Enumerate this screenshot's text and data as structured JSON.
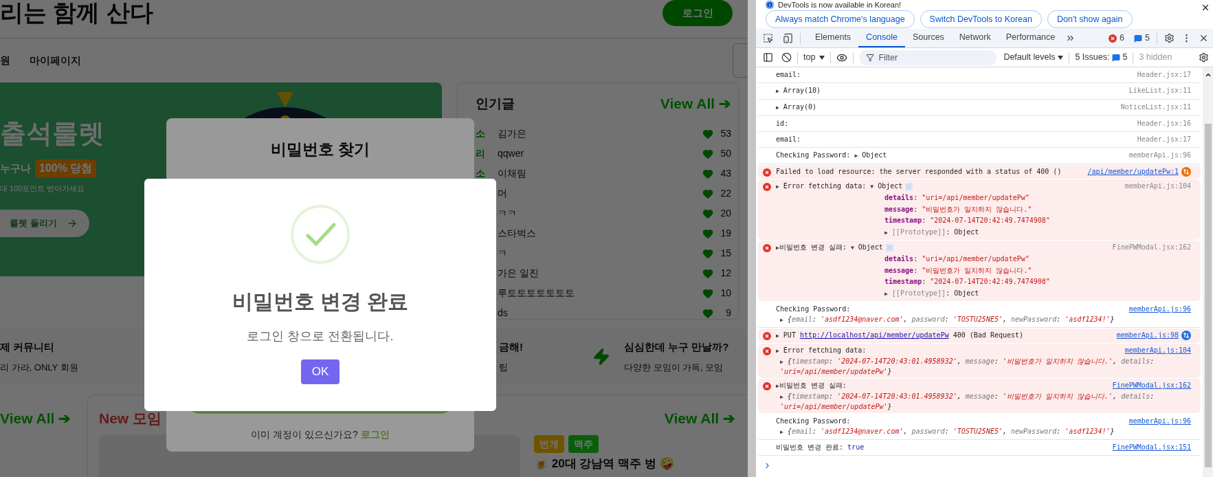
{
  "page": {
    "site_title": "리는 함께 산다",
    "login_button": "로그인",
    "nav": [
      {
        "label": "원"
      },
      {
        "label": "마이페이지"
      }
    ],
    "banner": {
      "title": "출석룰렛",
      "lead": "누구나",
      "badge": "100% 당첨",
      "subtitle": "대 100포인트 받아가세요",
      "button": "룰렛 돌리기"
    },
    "popular": {
      "title": "인기글",
      "view_all": "View All ➔",
      "posts": [
        {
          "category": "소",
          "title": "김가은",
          "likes": "53"
        },
        {
          "category": "리",
          "title": "qqwer",
          "likes": "50"
        },
        {
          "category": "소",
          "title": "이채림",
          "likes": "43"
        },
        {
          "title": "머",
          "likes": "22"
        },
        {
          "title": "ㅋㅋ",
          "likes": "20"
        },
        {
          "title": "스타벅스",
          "likes": "19"
        },
        {
          "title": "ㅋ",
          "likes": "15"
        },
        {
          "title": "가은 일진",
          "likes": "12"
        },
        {
          "title": "루토토토토토토토",
          "likes": "10"
        },
        {
          "title": "ds",
          "likes": "9"
        }
      ]
    },
    "features": [
      {
        "title": "제 커뮤니티",
        "text": "리 가라, ONLY 회원",
        "icon": false
      },
      {
        "title": "금해!",
        "text": "팁",
        "icon": false
      },
      {
        "title": "심심한데 누구 만날까?",
        "text": "다양한 모임이 가득, 모임",
        "icon": true
      }
    ],
    "view_all_left": "View All ➔",
    "meetings": {
      "title": "New 모임",
      "view_all": "View All ➔",
      "tags": [
        {
          "label": "번개",
          "color": "#705400"
        },
        {
          "label": "맥주",
          "color": "#0a600a"
        }
      ],
      "meeting_title": "🍺 20대 강남역 맥주 벙 🤪"
    }
  },
  "find_password_modal": {
    "title": "비밀번호 찾기",
    "footer_text": "이미 계정이 있으신가요? ",
    "footer_link": "로그인"
  },
  "success_modal": {
    "title": "비밀번호 변경 완료",
    "text": "로그인 창으로 전환됩니다.",
    "button": "OK"
  },
  "devtools": {
    "notice": "DevTools is now available in Korean!",
    "notice_buttons": [
      "Always match Chrome's language",
      "Switch DevTools to Korean",
      "Don't show again"
    ],
    "tabs": [
      {
        "label": "Elements",
        "selected": false
      },
      {
        "label": "Console",
        "selected": true
      },
      {
        "label": "Sources",
        "selected": false
      },
      {
        "label": "Network",
        "selected": false
      },
      {
        "label": "Performance",
        "selected": false
      }
    ],
    "error_count": "6",
    "message_count": "5",
    "context": "top",
    "filter_placeholder": "Filter",
    "levels": "Default levels",
    "issues_label": "5 Issues:",
    "issues_count": "5",
    "hidden": "3 hidden",
    "messages": [
      {
        "kind": "log",
        "source": "Header.jsx:17",
        "source_link": false,
        "info_badge": false,
        "segments": [
          {
            "kind": "plain",
            "text": "email:"
          }
        ]
      },
      {
        "kind": "log",
        "source": "LikeList.jsx:11",
        "source_link": false,
        "info_badge": false,
        "segments": [
          {
            "kind": "arrow",
            "text": "▶"
          },
          {
            "kind": "plain",
            "text": " Array(10)"
          }
        ]
      },
      {
        "kind": "log",
        "source": "NoticeList.jsx:11",
        "source_link": false,
        "info_badge": false,
        "segments": [
          {
            "kind": "arrow",
            "text": "▶"
          },
          {
            "kind": "plain",
            "text": " Array(0)"
          }
        ]
      },
      {
        "kind": "log",
        "source": "Header.jsx:16",
        "source_link": false,
        "info_badge": false,
        "segments": [
          {
            "kind": "plain",
            "text": "id:"
          }
        ]
      },
      {
        "kind": "log",
        "source": "Header.jsx:17",
        "source_link": false,
        "info_badge": false,
        "segments": [
          {
            "kind": "plain",
            "text": "email:"
          }
        ]
      },
      {
        "kind": "log",
        "source": "memberApi.js:96",
        "source_link": false,
        "info_badge": false,
        "segments": [
          {
            "kind": "plain",
            "text": "Checking Password: "
          },
          {
            "kind": "arrow",
            "text": "▶"
          },
          {
            "kind": "plain",
            "text": " Object"
          }
        ]
      },
      {
        "kind": "error",
        "source": "/api/member/updatePw:1",
        "source_link": true,
        "info_badge": false,
        "color": "#e8710a",
        "segments": [
          {
            "kind": "plain",
            "text": "Failed to load resource: the server responded with a status of 400 ()"
          }
        ]
      },
      {
        "kind": "error",
        "source": "memberApi.js:104",
        "source_link": false,
        "info_badge": true,
        "segments": [
          {
            "kind": "arrow",
            "text": "▶"
          },
          {
            "kind": "plain",
            "text": " Error fetching data: "
          },
          {
            "kind": "arrow",
            "text": "▼"
          },
          {
            "kind": "plain",
            "text": " Object"
          }
        ],
        "props": [
          [
            {
              "kind": "key",
              "text": "details"
            },
            {
              "kind": "plain",
              "text": ": "
            },
            {
              "kind": "string",
              "text": "\"uri=/api/member/updatePw\""
            }
          ],
          [
            {
              "kind": "key",
              "text": "message"
            },
            {
              "kind": "plain",
              "text": ": "
            },
            {
              "kind": "string",
              "text": "\"비밀번호가 일치하지 않습니다.\""
            }
          ],
          [
            {
              "kind": "key",
              "text": "timestamp"
            },
            {
              "kind": "plain",
              "text": ": "
            },
            {
              "kind": "string",
              "text": "\"2024-07-14T20:42:49.7474908\""
            }
          ],
          [
            {
              "kind": "arrow",
              "text": "▶"
            },
            {
              "kind": "proto",
              "text": " [[Prototype]]"
            },
            {
              "kind": "plain",
              "text": ": Object"
            }
          ]
        ]
      },
      {
        "kind": "error",
        "source": "FinePWModal.jsx:162",
        "source_link": false,
        "info_badge": true,
        "segments": [
          {
            "kind": "arrow",
            "text": "▶"
          },
          {
            "kind": "plain",
            "text": "비밀번호 변경 실패: "
          },
          {
            "kind": "arrow",
            "text": "▼"
          },
          {
            "kind": "plain",
            "text": " Object"
          }
        ],
        "props": [
          [
            {
              "kind": "key",
              "text": "details"
            },
            {
              "kind": "plain",
              "text": ": "
            },
            {
              "kind": "string",
              "text": "\"uri=/api/member/updatePw\""
            }
          ],
          [
            {
              "kind": "key",
              "text": "message"
            },
            {
              "kind": "plain",
              "text": ": "
            },
            {
              "kind": "string",
              "text": "\"비밀번호가 일치하지 않습니다.\""
            }
          ],
          [
            {
              "kind": "key",
              "text": "timestamp"
            },
            {
              "kind": "plain",
              "text": ": "
            },
            {
              "kind": "string",
              "text": "\"2024-07-14T20:42:49.7474908\""
            }
          ],
          [
            {
              "kind": "arrow",
              "text": "▶"
            },
            {
              "kind": "proto",
              "text": " [[Prototype]]"
            },
            {
              "kind": "plain",
              "text": ": Object"
            }
          ]
        ]
      },
      {
        "kind": "log",
        "source": "memberApi.js:96",
        "source_link": true,
        "info_badge": false,
        "segments": [
          {
            "kind": "plain",
            "text": "Checking Password:"
          }
        ],
        "preview": [
          {
            "kind": "arrow",
            "text": "▶"
          },
          {
            "kind": "plain",
            "text": " {"
          },
          {
            "kind": "dim",
            "text": "email"
          },
          {
            "kind": "plain",
            "text": ": "
          },
          {
            "kind": "string",
            "text": "'asdf1234@naver.com'"
          },
          {
            "kind": "plain",
            "text": ", "
          },
          {
            "kind": "dim",
            "text": "password"
          },
          {
            "kind": "plain",
            "text": ": "
          },
          {
            "kind": "string",
            "text": "'TOSTU25NE5'"
          },
          {
            "kind": "plain",
            "text": ", "
          },
          {
            "kind": "dim",
            "text": "newPassword"
          },
          {
            "kind": "plain",
            "text": ": "
          },
          {
            "kind": "string",
            "text": "'asdf1234!'"
          },
          {
            "kind": "plain",
            "text": "}"
          }
        ]
      },
      {
        "kind": "error",
        "source": "memberApi.js:98",
        "source_link": true,
        "info_badge": false,
        "color": "#1a73e8",
        "segments": [
          {
            "kind": "arrow",
            "text": "▶"
          },
          {
            "kind": "plain",
            "text": " PUT "
          },
          {
            "kind": "link",
            "text": "http://localhost/api/member/updatePw"
          },
          {
            "kind": "plain",
            "text": " 400 (Bad Request)"
          }
        ]
      },
      {
        "kind": "error",
        "source": "memberApi.js:104",
        "source_link": true,
        "info_badge": false,
        "segments": [
          {
            "kind": "arrow",
            "text": "▶"
          },
          {
            "kind": "plain",
            "text": " Error fetching data:"
          }
        ],
        "preview": [
          {
            "kind": "arrow",
            "text": "▶"
          },
          {
            "kind": "plain",
            "text": " {"
          },
          {
            "kind": "dim",
            "text": "timestamp"
          },
          {
            "kind": "plain",
            "text": ": "
          },
          {
            "kind": "string",
            "text": "'2024-07-14T20:43:01.4958932'"
          },
          {
            "kind": "plain",
            "text": ", "
          },
          {
            "kind": "dim",
            "text": "message"
          },
          {
            "kind": "plain",
            "text": ": "
          },
          {
            "kind": "string",
            "text": "'비밀번호가 일치하지 않습니다.'"
          },
          {
            "kind": "plain",
            "text": ", "
          },
          {
            "kind": "dim",
            "text": "details"
          },
          {
            "kind": "plain",
            "text": ": "
          },
          {
            "kind": "string",
            "text": "'uri=/api/member/updatePw'"
          },
          {
            "kind": "plain",
            "text": "}"
          }
        ]
      },
      {
        "kind": "error",
        "source": "FinePWModal.jsx:162",
        "source_link": true,
        "info_badge": false,
        "segments": [
          {
            "kind": "arrow",
            "text": "▶"
          },
          {
            "kind": "plain",
            "text": "비밀번호 변경 실패:"
          }
        ],
        "preview": [
          {
            "kind": "arrow",
            "text": "▶"
          },
          {
            "kind": "plain",
            "text": " {"
          },
          {
            "kind": "dim",
            "text": "timestamp"
          },
          {
            "kind": "plain",
            "text": ": "
          },
          {
            "kind": "string",
            "text": "'2024-07-14T20:43:01.4958932'"
          },
          {
            "kind": "plain",
            "text": ", "
          },
          {
            "kind": "dim",
            "text": "message"
          },
          {
            "kind": "plain",
            "text": ": "
          },
          {
            "kind": "string",
            "text": "'비밀번호가 일치하지 않습니다.'"
          },
          {
            "kind": "plain",
            "text": ", "
          },
          {
            "kind": "dim",
            "text": "details"
          },
          {
            "kind": "plain",
            "text": ": "
          },
          {
            "kind": "string",
            "text": "'uri=/api/member/updatePw'"
          },
          {
            "kind": "plain",
            "text": "}"
          }
        ]
      },
      {
        "kind": "log",
        "source": "memberApi.js:96",
        "source_link": true,
        "info_badge": false,
        "segments": [
          {
            "kind": "plain",
            "text": "Checking Password:"
          }
        ],
        "preview": [
          {
            "kind": "arrow",
            "text": "▶"
          },
          {
            "kind": "plain",
            "text": " {"
          },
          {
            "kind": "dim",
            "text": "email"
          },
          {
            "kind": "plain",
            "text": ": "
          },
          {
            "kind": "string",
            "text": "'asdf1234@naver.com'"
          },
          {
            "kind": "plain",
            "text": ", "
          },
          {
            "kind": "dim",
            "text": "password"
          },
          {
            "kind": "plain",
            "text": ": "
          },
          {
            "kind": "string",
            "text": "'TOSTU25NE5'"
          },
          {
            "kind": "plain",
            "text": ", "
          },
          {
            "kind": "dim",
            "text": "newPassword"
          },
          {
            "kind": "plain",
            "text": ": "
          },
          {
            "kind": "string",
            "text": "'asdf1234!'"
          },
          {
            "kind": "plain",
            "text": "}"
          }
        ]
      },
      {
        "kind": "log",
        "source": "FinePWModal.jsx:151",
        "source_link": true,
        "info_badge": false,
        "segments": [
          {
            "kind": "plain",
            "text": "비밀번호 변경 완료: "
          },
          {
            "kind": "bool",
            "text": "true"
          }
        ]
      }
    ]
  }
}
